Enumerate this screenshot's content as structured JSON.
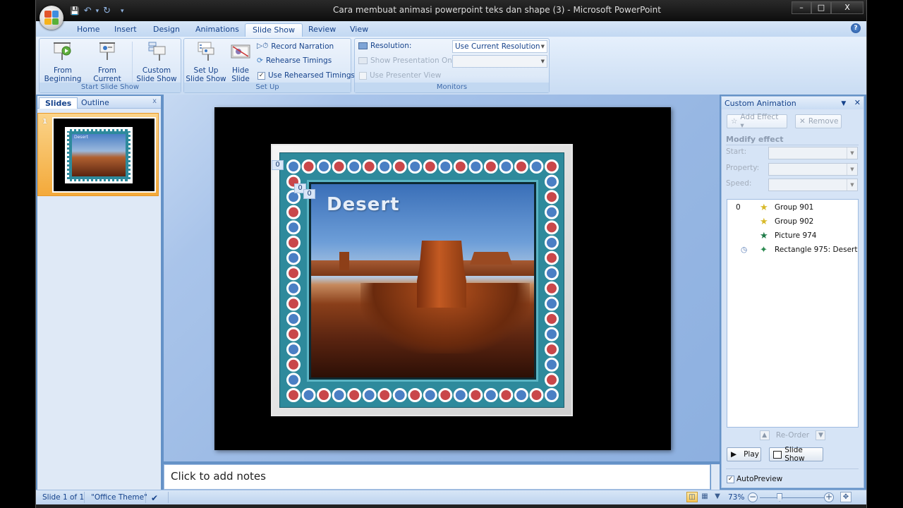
{
  "window": {
    "title": "Cara membuat animasi powerpoint teks dan shape (3)  -  Microsoft PowerPoint",
    "controls": {
      "minimize": "–",
      "maximize": "□",
      "close": "X"
    }
  },
  "qat": {
    "save": "💾",
    "undo": "↶",
    "undo_dd": "▾",
    "redo": "↻",
    "customize": "▾"
  },
  "tabs": [
    {
      "label": "Home"
    },
    {
      "label": "Insert"
    },
    {
      "label": "Design"
    },
    {
      "label": "Animations"
    },
    {
      "label": "Slide Show",
      "active": true
    },
    {
      "label": "Review"
    },
    {
      "label": "View"
    }
  ],
  "help": "?",
  "ribbon": {
    "start_group": {
      "label": "Start Slide Show",
      "from_beginning": [
        "From",
        "Beginning"
      ],
      "from_current": [
        "From",
        "Current Slide"
      ],
      "custom": [
        "Custom",
        "Slide Show ▾"
      ]
    },
    "setup_group": {
      "label": "Set Up",
      "setup_show": [
        "Set Up",
        "Slide Show"
      ],
      "hide_slide": [
        "Hide",
        "Slide"
      ],
      "record_narration": "Record Narration",
      "rehearse_timings": "Rehearse Timings",
      "use_rehearsed": "Use Rehearsed Timings",
      "use_rehearsed_checked": true
    },
    "monitors_group": {
      "label": "Monitors",
      "resolution_label": "Resolution:",
      "resolution_value": "Use Current Resolution",
      "show_on_label": "Show Presentation On:",
      "show_on_value": "",
      "presenter_view": "Use Presenter View",
      "presenter_view_checked": false
    }
  },
  "left_pane": {
    "tabs": [
      {
        "label": "Slides",
        "active": true
      },
      {
        "label": "Outline"
      }
    ],
    "close": "x",
    "thumbnails": [
      {
        "number": "1",
        "title": "Desert"
      }
    ]
  },
  "slide": {
    "title": "Desert",
    "animation_tags": [
      "0",
      "0",
      "0"
    ],
    "dot_colors": {
      "red": "#c9474a",
      "blue": "#4a7fc4",
      "teal": "#2e8a9c"
    }
  },
  "notes": {
    "placeholder": "Click to add notes"
  },
  "custom_animation": {
    "title": "Custom Animation",
    "menu": "▼",
    "close": "✕",
    "add_effect": "Add Effect ▾",
    "remove": "Remove",
    "modify_effect": "Modify effect",
    "fields": [
      {
        "label": "Start:",
        "value": ""
      },
      {
        "label": "Property:",
        "value": ""
      },
      {
        "label": "Speed:",
        "value": ""
      }
    ],
    "items": [
      {
        "order": "0",
        "name": "Group 901",
        "icon": "star-yellow",
        "color": "#d8b928",
        "trigger": ""
      },
      {
        "order": "",
        "name": "Group 902",
        "icon": "star-yellow",
        "color": "#d8b928",
        "trigger": ""
      },
      {
        "order": "",
        "name": "Picture 974",
        "icon": "star-green",
        "color": "#1e7a48",
        "trigger": ""
      },
      {
        "order": "",
        "name": "Rectangle 975: Desert",
        "icon": "motion-green",
        "color": "#2c8a50",
        "trigger": "clock"
      }
    ],
    "reorder_label": "Re-Order",
    "play": "Play",
    "slide_show": "Slide Show",
    "autopreview": "AutoPreview",
    "autopreview_checked": true
  },
  "status": {
    "slide_info": "Slide 1 of 1",
    "theme": "\"Office Theme\"",
    "zoom": "73%",
    "zoom_fraction": 0.3
  }
}
